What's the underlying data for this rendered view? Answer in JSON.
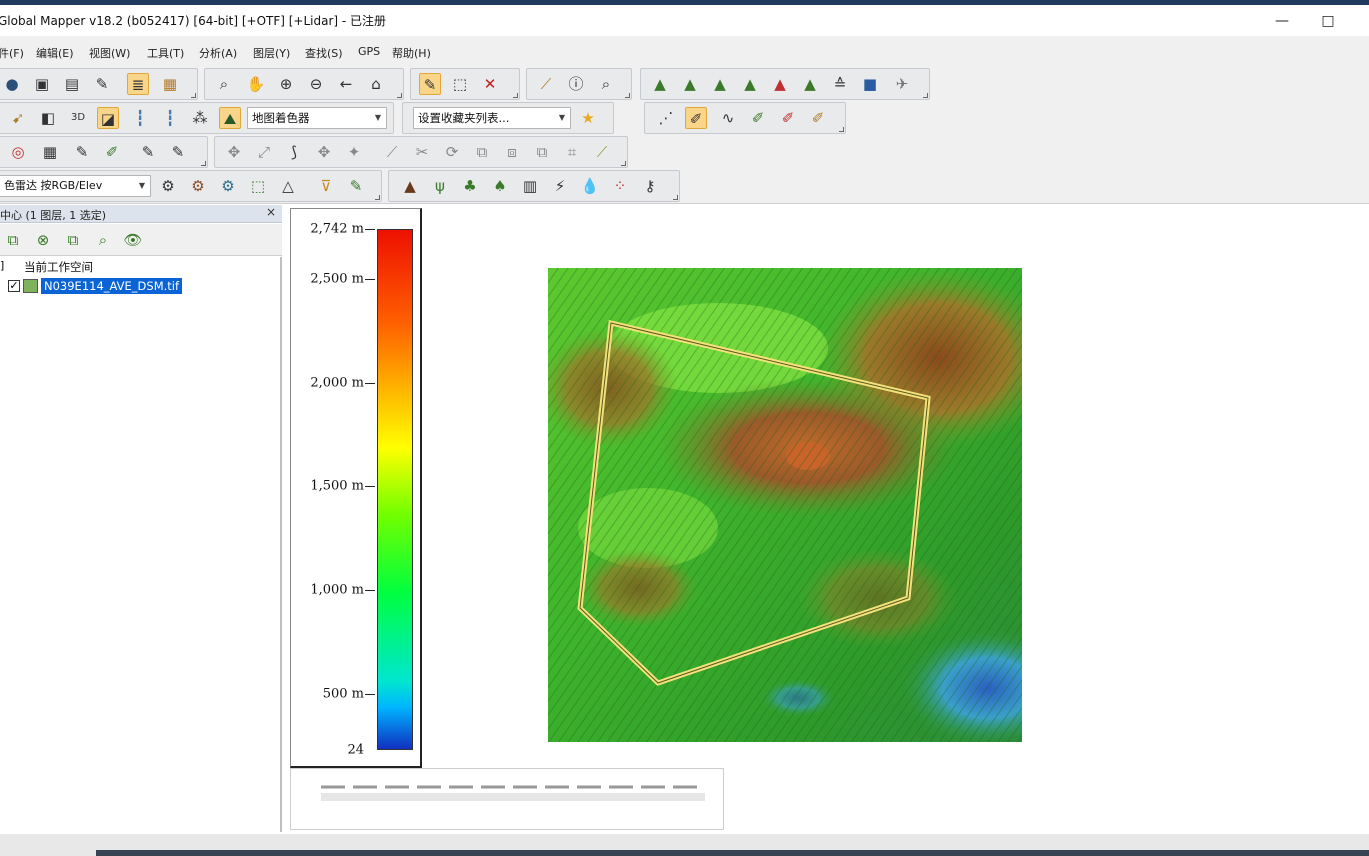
{
  "window": {
    "title": "Global Mapper v18.2 (b052417) [64-bit] [+OTF] [+Lidar] - 已注册",
    "minimize_glyph": "—",
    "maximize_glyph": "□"
  },
  "menubar": [
    "件(F)",
    "编辑(E)",
    "视图(W)",
    "工具(T)",
    "分析(A)",
    "图层(Y)",
    "查找(S)",
    "GPS",
    "帮助(H)"
  ],
  "toolbars": {
    "shader_combo": "地图着色器",
    "favorites_combo": "设置收藏夹列表...",
    "lidar_combo": "色雷达 按RGB/Elev"
  },
  "control_center": {
    "title": "中心 (1 图层, 1 选定)",
    "close_glyph": "×",
    "workspace_label": "当前工作空间",
    "layer_name": "N039E114_AVE_DSM.tif",
    "layer_checked": "✓"
  },
  "legend": {
    "ticks": [
      "2,742 m",
      "2,500 m",
      "2,000 m",
      "1,500 m",
      "1,000 m",
      "500 m",
      "24"
    ],
    "min_value": 24,
    "max_value": 2742,
    "colors": [
      "#1030c0",
      "#00b4ff",
      "#00e6d0",
      "#00ff40",
      "#70ff00",
      "#ffff00",
      "#ffb000",
      "#ff6000",
      "#ee1000"
    ]
  },
  "map": {
    "aoi_color": "#f3e27a",
    "dem_colors": [
      "#2ea32a",
      "#5ec92f",
      "#8fd43a",
      "#c9a13b",
      "#9a5a2a",
      "#6b3a1c",
      "#3aa0c8"
    ]
  }
}
